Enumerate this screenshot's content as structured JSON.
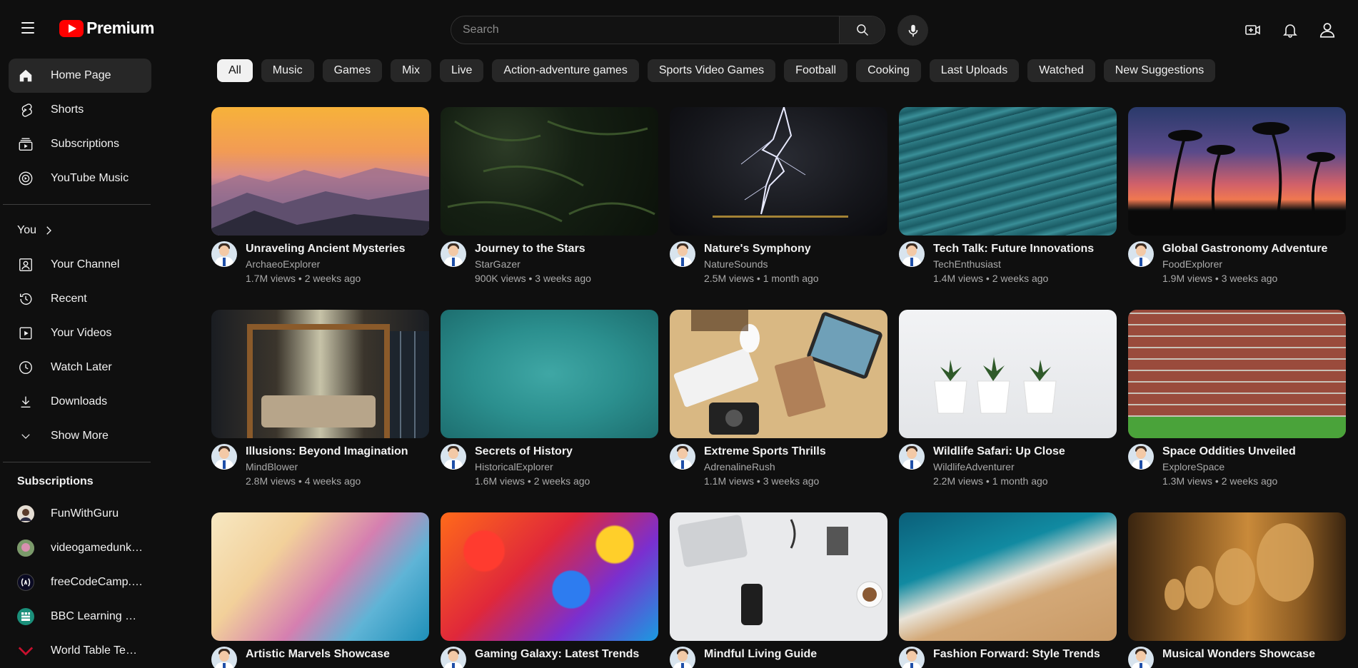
{
  "app": {
    "logo_text": "Premium"
  },
  "search": {
    "placeholder": "Search"
  },
  "sidebar": {
    "main": [
      {
        "label": "Home Page",
        "icon": "home-icon",
        "active": true
      },
      {
        "label": "Shorts",
        "icon": "shorts-icon"
      },
      {
        "label": "Subscriptions",
        "icon": "subscriptions-icon"
      },
      {
        "label": "YouTube Music",
        "icon": "music-icon"
      }
    ],
    "you_label": "You",
    "you_items": [
      {
        "label": "Your Channel",
        "icon": "channel-icon"
      },
      {
        "label": "Recent",
        "icon": "history-icon"
      },
      {
        "label": "Your Videos",
        "icon": "videos-icon"
      },
      {
        "label": "Watch Later",
        "icon": "clock-icon"
      },
      {
        "label": "Downloads",
        "icon": "download-icon"
      },
      {
        "label": "Show More",
        "icon": "chevron-down-icon"
      }
    ],
    "subscriptions_title": "Subscriptions",
    "subscriptions": [
      {
        "label": "FunWithGuru",
        "color": "#6b4b3a"
      },
      {
        "label": "videogamedunkey",
        "color": "#a0607a"
      },
      {
        "label": "freeCodeCamp.org",
        "color": "#0a0a23"
      },
      {
        "label": "BBC Learning En...",
        "color": "#1a8f7a"
      },
      {
        "label": "World Table Tennis",
        "color": "#c8102e"
      }
    ]
  },
  "chips": [
    "All",
    "Music",
    "Games",
    "Mix",
    "Live",
    "Action-adventure games",
    "Sports Video Games",
    "Football",
    "Cooking",
    "Last Uploads",
    "Watched",
    "New Suggestions"
  ],
  "videos": [
    {
      "title": "Unraveling Ancient Mysteries",
      "channel": "ArchaeoExplorer",
      "views": "1.7M views",
      "ago": "2 weeks ago"
    },
    {
      "title": "Journey to the Stars",
      "channel": "StarGazer",
      "views": "900K views",
      "ago": "3 weeks ago"
    },
    {
      "title": "Nature's Symphony",
      "channel": "NatureSounds",
      "views": "2.5M views",
      "ago": "1 month ago"
    },
    {
      "title": "Tech Talk: Future Innovations",
      "channel": "TechEnthusiast",
      "views": "1.4M views",
      "ago": "2 weeks ago"
    },
    {
      "title": "Global Gastronomy Adventure",
      "channel": "FoodExplorer",
      "views": "1.9M views",
      "ago": "3 weeks ago"
    },
    {
      "title": "Illusions: Beyond Imagination",
      "channel": "MindBlower",
      "views": "2.8M views",
      "ago": "4 weeks ago"
    },
    {
      "title": "Secrets of History",
      "channel": "HistoricalExplorer",
      "views": "1.6M views",
      "ago": "2 weeks ago"
    },
    {
      "title": "Extreme Sports Thrills",
      "channel": "AdrenalineRush",
      "views": "1.1M views",
      "ago": "3 weeks ago"
    },
    {
      "title": "Wildlife Safari: Up Close",
      "channel": "WildlifeAdventurer",
      "views": "2.2M views",
      "ago": "1 month ago"
    },
    {
      "title": "Space Oddities Unveiled",
      "channel": "ExploreSpace",
      "views": "1.3M views",
      "ago": "2 weeks ago"
    },
    {
      "title": "Artistic Marvels Showcase",
      "channel": "",
      "views": "",
      "ago": ""
    },
    {
      "title": "Gaming Galaxy: Latest Trends",
      "channel": "",
      "views": "",
      "ago": ""
    },
    {
      "title": "Mindful Living Guide",
      "channel": "",
      "views": "",
      "ago": ""
    },
    {
      "title": "Fashion Forward: Style Trends",
      "channel": "",
      "views": "",
      "ago": ""
    },
    {
      "title": "Musical Wonders Showcase",
      "channel": "",
      "views": "",
      "ago": ""
    }
  ]
}
